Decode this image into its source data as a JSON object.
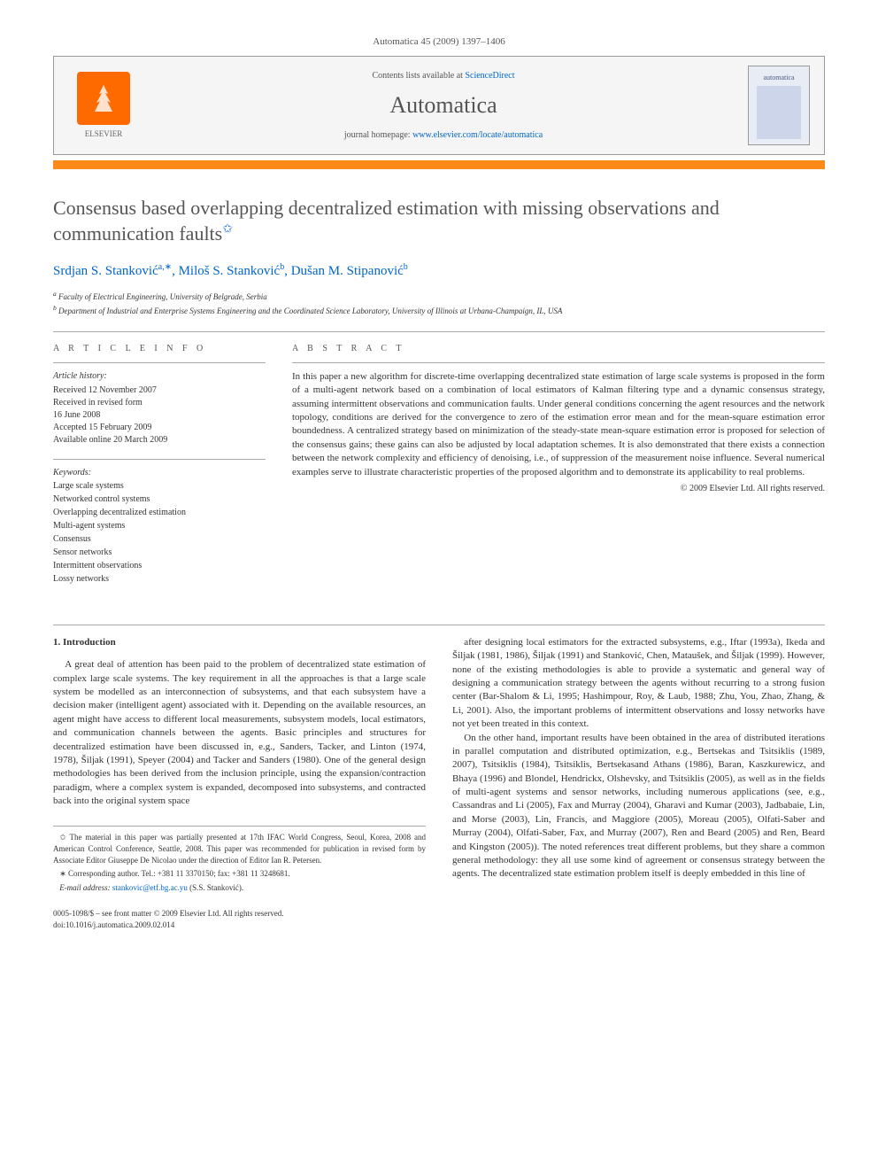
{
  "header": {
    "running_head": "Automatica 45 (2009) 1397–1406",
    "contents_line_prefix": "Contents lists available at ",
    "contents_line_link": "ScienceDirect",
    "journal_name": "Automatica",
    "homepage_prefix": "journal homepage: ",
    "homepage_link": "www.elsevier.com/locate/automatica",
    "publisher_label": "ELSEVIER",
    "cover_label": "automatica"
  },
  "article": {
    "title": "Consensus based overlapping decentralized estimation with missing observations and communication faults",
    "title_fn_mark": "✩",
    "authors_html": "Srdjan S. Stanković",
    "authors": [
      {
        "name": "Srdjan S. Stanković",
        "sup": "a,∗"
      },
      {
        "name": "Miloš S. Stanković",
        "sup": "b"
      },
      {
        "name": "Dušan M. Stipanović",
        "sup": "b"
      }
    ],
    "affiliations": [
      {
        "sup": "a",
        "text": "Faculty of Electrical Engineering, University of Belgrade, Serbia"
      },
      {
        "sup": "b",
        "text": "Department of Industrial and Enterprise Systems Engineering and the Coordinated Science Laboratory, University of Illinois at Urbana-Champaign, IL, USA"
      }
    ]
  },
  "info": {
    "heading": "A R T I C L E   I N F O",
    "history_heading": "Article history:",
    "history": [
      "Received 12 November 2007",
      "Received in revised form",
      "16 June 2008",
      "Accepted 15 February 2009",
      "Available online 20 March 2009"
    ],
    "keywords_heading": "Keywords:",
    "keywords": [
      "Large scale systems",
      "Networked control systems",
      "Overlapping decentralized estimation",
      "Multi-agent systems",
      "Consensus",
      "Sensor networks",
      "Intermittent observations",
      "Lossy networks"
    ]
  },
  "abstract": {
    "heading": "A B S T R A C T",
    "text": "In this paper a new algorithm for discrete-time overlapping decentralized state estimation of large scale systems is proposed in the form of a multi-agent network based on a combination of local estimators of Kalman filtering type and a dynamic consensus strategy, assuming intermittent observations and communication faults. Under general conditions concerning the agent resources and the network topology, conditions are derived for the convergence to zero of the estimation error mean and for the mean-square estimation error boundedness. A centralized strategy based on minimization of the steady-state mean-square estimation error is proposed for selection of the consensus gains; these gains can also be adjusted by local adaptation schemes. It is also demonstrated that there exists a connection between the network complexity and efficiency of denoising, i.e., of suppression of the measurement noise influence. Several numerical examples serve to illustrate characteristic properties of the proposed algorithm and to demonstrate its applicability to real problems.",
    "copyright": "© 2009 Elsevier Ltd. All rights reserved."
  },
  "body": {
    "section_heading": "1. Introduction",
    "col1_p1": "A great deal of attention has been paid to the problem of decentralized state estimation of complex large scale systems. The key requirement in all the approaches is that a large scale system be modelled as an interconnection of subsystems, and that each subsystem have a decision maker (intelligent agent) associated with it. Depending on the available resources, an agent might have access to different local measurements, subsystem models, local estimators, and communication channels between the agents. Basic principles and structures for decentralized estimation have been discussed in, e.g., Sanders, Tacker, and Linton (1974, 1978), Šiljak (1991), Speyer (2004) and Tacker and Sanders (1980). One of the general design methodologies has been derived from the inclusion principle, using the expansion/contraction paradigm, where a complex system is expanded, decomposed into subsystems, and contracted back into the original system space",
    "col2_p1": "after designing local estimators for the extracted subsystems, e.g., Iftar (1993a), Ikeda and Šiljak (1981, 1986), Šiljak (1991) and Stanković, Chen, Mataušek, and Šiljak (1999). However, none of the existing methodologies is able to provide a systematic and general way of designing a communication strategy between the agents without recurring to a strong fusion center (Bar-Shalom & Li, 1995; Hashimpour, Roy, & Laub, 1988; Zhu, You, Zhao, Zhang, & Li, 2001). Also, the important problems of intermittent observations and lossy networks have not yet been treated in this context.",
    "col2_p2": "On the other hand, important results have been obtained in the area of distributed iterations in parallel computation and distributed optimization, e.g., Bertsekas and Tsitsiklis (1989, 2007), Tsitsiklis (1984), Tsitsiklis, Bertsekasand Athans (1986), Baran, Kaszkurewicz, and Bhaya (1996) and Blondel, Hendrickx, Olshevsky, and Tsitsiklis (2005), as well as in the fields of multi-agent systems and sensor networks, including numerous applications (see, e.g., Cassandras and Li (2005), Fax and Murray (2004), Gharavi and Kumar (2003), Jadbabaie, Lin, and Morse (2003), Lin, Francis, and Maggiore (2005), Moreau (2005), Olfati-Saber and Murray (2004), Olfati-Saber, Fax, and Murray (2007), Ren and Beard (2005) and Ren, Beard and Kingston (2005)). The noted references treat different problems, but they share a common general methodology: they all use some kind of agreement or consensus strategy between the agents. The decentralized state estimation problem itself is deeply embedded in this line of"
  },
  "footnotes": {
    "fn1": "✩ The material in this paper was partially presented at 17th IFAC World Congress, Seoul, Korea, 2008 and American Control Conference, Seattle, 2008. This paper was recommended for publication in revised form by Associate Editor Giuseppe De Nicolao under the direction of Editor Ian R. Petersen.",
    "fn2": "∗ Corresponding author. Tel.: +381 11 3370150; fax: +381 11 3248681.",
    "fn3_label": "E-mail address:",
    "fn3_email": "stankovic@etf.bg.ac.yu",
    "fn3_tail": " (S.S. Stanković)."
  },
  "footer": {
    "line1": "0005-1098/$ – see front matter © 2009 Elsevier Ltd. All rights reserved.",
    "line2": "doi:10.1016/j.automatica.2009.02.014"
  }
}
